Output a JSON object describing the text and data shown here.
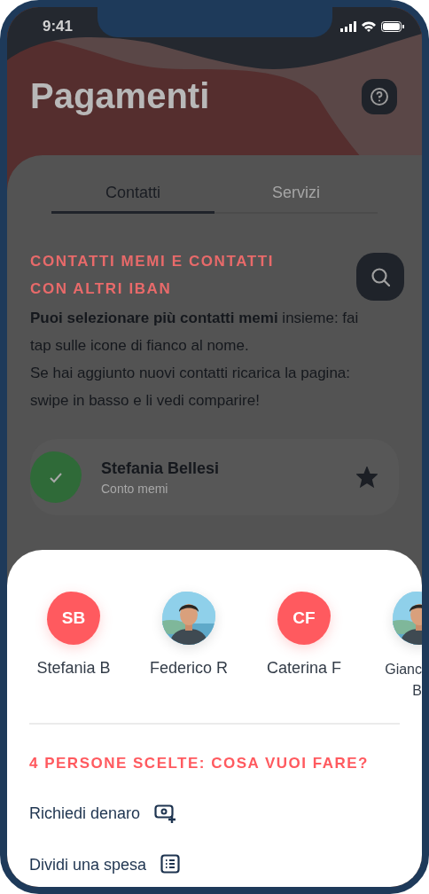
{
  "status_bar": {
    "time": "9:41"
  },
  "title": "Pagamenti",
  "tabs": [
    {
      "label": "Contatti",
      "selected": true
    },
    {
      "label": "Servizi",
      "selected": false
    }
  ],
  "section_heading": "CONTATTI MEMI E CONTATTI CON ALTRI IBAN",
  "paragraphs": [
    "**Puoi selezionare più contatti memi** insieme: fai tap sulle icone di fianco al nome.",
    "Se hai aggiunto nuovi contatti ricarica la pagina: swipe in basso e li vedi comparire!"
  ],
  "contact": {
    "name": "Stefania Bellesi",
    "account": "Conto memi",
    "selected": true,
    "favorite": true
  },
  "sheet": {
    "people": [
      {
        "kind": "initials",
        "initials": "SB",
        "name": "Stefania B",
        "clipped": false
      },
      {
        "name": "Federico R",
        "clipped": false
      },
      {
        "kind": "initials",
        "initials": "CF",
        "name": "Caterina F",
        "clipped": false
      },
      {
        "name": "Gianc B",
        "clipped": true
      }
    ],
    "heading": "4 PERSONE SCELTE: COSA VUOI FARE?",
    "actions": [
      {
        "label": "Richiedi denaro",
        "kind": "request"
      },
      {
        "label": "Dividi una spesa",
        "kind": "split"
      }
    ]
  }
}
